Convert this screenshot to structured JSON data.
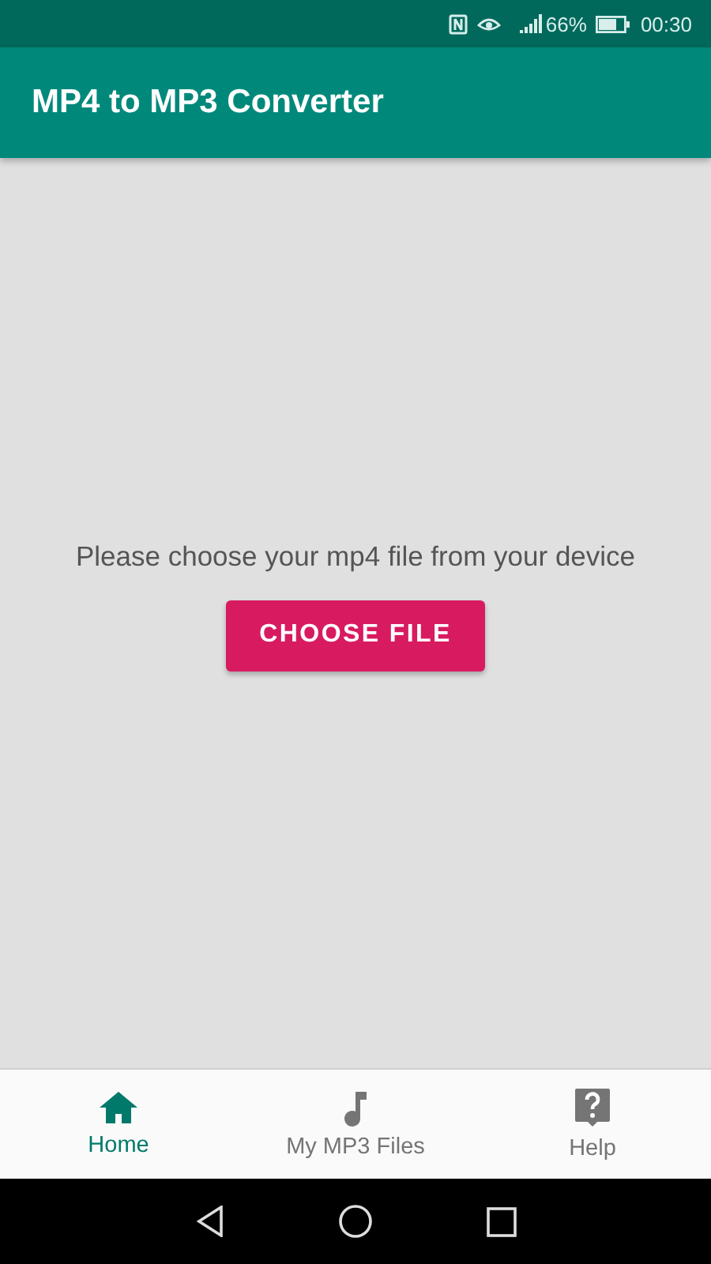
{
  "status_bar": {
    "battery": "66%",
    "time": "00:30"
  },
  "app_bar": {
    "title": "MP4 to MP3 Converter"
  },
  "content": {
    "prompt": "Please choose your mp4 file from your device",
    "button": "CHOOSE FILE"
  },
  "bottom_nav": [
    {
      "kind": "home",
      "label": "Home",
      "selected": true
    },
    {
      "kind": "music",
      "label": "My MP3 Files",
      "selected": false
    },
    {
      "kind": "help",
      "label": "Help",
      "selected": false
    }
  ]
}
